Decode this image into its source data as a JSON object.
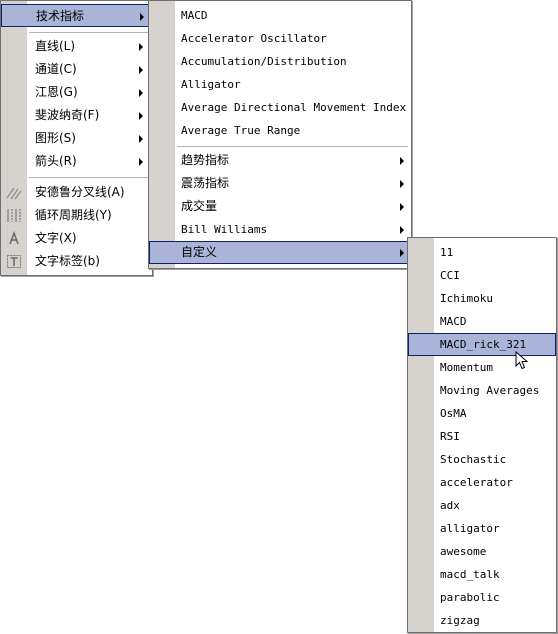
{
  "menu1": {
    "items": [
      {
        "label": "技术指标",
        "selected": true
      },
      {
        "label": "直线(L)"
      },
      {
        "label": "通道(C)"
      },
      {
        "label": "江恩(G)"
      },
      {
        "label": "斐波纳奇(F)"
      },
      {
        "label": "图形(S)"
      },
      {
        "label": "箭头(R)"
      },
      {
        "label": "安德鲁分叉线(A)",
        "icon": "pitchfork-icon"
      },
      {
        "label": "循环周期线(Y)",
        "icon": "cycle-lines-icon"
      },
      {
        "label": "文字(X)",
        "icon": "text-icon"
      },
      {
        "label": "文字标签(b)",
        "icon": "text-label-icon"
      }
    ]
  },
  "menu2": {
    "items": [
      {
        "label": "MACD"
      },
      {
        "label": "Accelerator Oscillator"
      },
      {
        "label": "Accumulation/Distribution"
      },
      {
        "label": "Alligator"
      },
      {
        "label": "Average Directional Movement Index"
      },
      {
        "label": "Average True Range"
      },
      {
        "label": "趋势指标"
      },
      {
        "label": "震荡指标"
      },
      {
        "label": "成交量"
      },
      {
        "label": "Bill Williams"
      },
      {
        "label": "自定义",
        "selected": true
      }
    ]
  },
  "menu3": {
    "items": [
      {
        "label": "11"
      },
      {
        "label": "CCI"
      },
      {
        "label": "Ichimoku"
      },
      {
        "label": "MACD"
      },
      {
        "label": "MACD_rick_321",
        "selected": true
      },
      {
        "label": "Momentum"
      },
      {
        "label": "Moving Averages"
      },
      {
        "label": "OsMA"
      },
      {
        "label": "RSI"
      },
      {
        "label": "Stochastic"
      },
      {
        "label": "accelerator"
      },
      {
        "label": "adx"
      },
      {
        "label": "alligator"
      },
      {
        "label": "awesome"
      },
      {
        "label": "macd_talk"
      },
      {
        "label": "parabolic"
      },
      {
        "label": "zigzag"
      }
    ]
  },
  "colors": {
    "selection_fill": "#aab4d9",
    "selection_border": "#0a246a",
    "gutter": "#d6d3ce"
  }
}
